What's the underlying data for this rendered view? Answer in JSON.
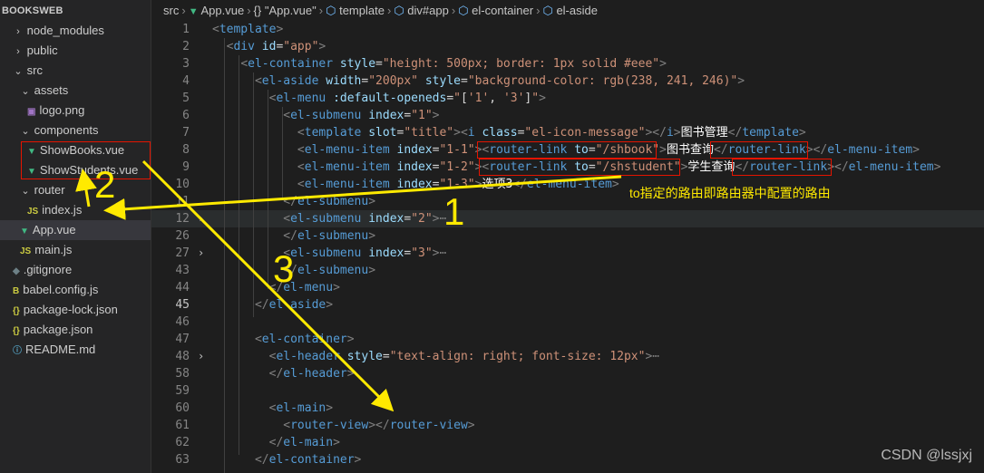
{
  "explorer": {
    "title": "BOOKSWEB",
    "items": [
      {
        "label": "node_modules",
        "twisty": "closed",
        "icon": "",
        "icon_color": ""
      },
      {
        "label": "public",
        "twisty": "closed",
        "icon": "",
        "icon_color": ""
      },
      {
        "label": "src",
        "twisty": "open",
        "icon": "",
        "icon_color": ""
      },
      {
        "label": "assets",
        "twisty": "open",
        "icon": "",
        "icon_color": ""
      },
      {
        "label": "logo.png",
        "twisty": "",
        "icon": "image-icon",
        "icon_color": "#a074c4"
      },
      {
        "label": "components",
        "twisty": "open",
        "icon": "",
        "icon_color": ""
      },
      {
        "label": "ShowBooks.vue",
        "twisty": "",
        "icon": "vue-icon",
        "icon_color": "#41b883"
      },
      {
        "label": "ShowStudents.vue",
        "twisty": "",
        "icon": "vue-icon",
        "icon_color": "#41b883"
      },
      {
        "label": "router",
        "twisty": "open",
        "icon": "",
        "icon_color": ""
      },
      {
        "label": "index.js",
        "twisty": "",
        "icon": "js-icon",
        "icon_color": "#cbcb41"
      },
      {
        "label": "App.vue",
        "twisty": "",
        "icon": "vue-icon",
        "icon_color": "#41b883"
      },
      {
        "label": "main.js",
        "twisty": "",
        "icon": "js-icon",
        "icon_color": "#cbcb41"
      },
      {
        "label": ".gitignore",
        "twisty": "",
        "icon": "git-icon",
        "icon_color": "#6d8086"
      },
      {
        "label": "babel.config.js",
        "twisty": "",
        "icon": "babel-icon",
        "icon_color": "#cbcb41"
      },
      {
        "label": "package-lock.json",
        "twisty": "",
        "icon": "json-icon",
        "icon_color": "#cbcb41"
      },
      {
        "label": "package.json",
        "twisty": "",
        "icon": "json-icon",
        "icon_color": "#cbcb41"
      },
      {
        "label": "README.md",
        "twisty": "",
        "icon": "info-icon",
        "icon_color": "#519aba"
      }
    ]
  },
  "breadcrumb": {
    "src": "src",
    "file": "App.vue",
    "obj": "{} \"App.vue\"",
    "template": "template",
    "div": "div#app",
    "container": "el-container",
    "aside": "el-aside"
  },
  "code_lines": [
    {
      "n": "1",
      "fold": "",
      "html": "<span class=\"p\">&lt;</span><span class=\"t\">template</span><span class=\"p\">&gt;</span>"
    },
    {
      "n": "2",
      "fold": "",
      "html": "  <span class=\"p\">&lt;</span><span class=\"t\">div</span> <span class=\"a\">id</span><span class=\"w\">=</span><span class=\"s\">\"app\"</span><span class=\"p\">&gt;</span>"
    },
    {
      "n": "3",
      "fold": "",
      "html": "    <span class=\"p\">&lt;</span><span class=\"t\">el-container</span> <span class=\"a\">style</span><span class=\"w\">=</span><span class=\"s\">\"height: 500px; border: 1px solid #eee\"</span><span class=\"p\">&gt;</span>"
    },
    {
      "n": "4",
      "fold": "",
      "html": "      <span class=\"p\">&lt;</span><span class=\"t\">el-aside</span> <span class=\"a\">width</span><span class=\"w\">=</span><span class=\"s\">\"200px\"</span> <span class=\"a\">style</span><span class=\"w\">=</span><span class=\"s\">\"background-color: rgb(238, 241, 246)\"</span><span class=\"p\">&gt;</span>"
    },
    {
      "n": "5",
      "fold": "",
      "html": "        <span class=\"p\">&lt;</span><span class=\"t\">el-menu</span> <span class=\"a\">:default-openeds</span><span class=\"w\">=</span><span class=\"s\">\"</span><span class=\"w\">[</span><span class=\"s\">'1'</span><span class=\"w\">, </span><span class=\"s\">'3'</span><span class=\"w\">]</span><span class=\"s\">\"</span><span class=\"p\">&gt;</span>"
    },
    {
      "n": "6",
      "fold": "",
      "html": "          <span class=\"p\">&lt;</span><span class=\"t\">el-submenu</span> <span class=\"a\">index</span><span class=\"w\">=</span><span class=\"s\">\"1\"</span><span class=\"p\">&gt;</span>"
    },
    {
      "n": "7",
      "fold": "",
      "html": "            <span class=\"p\">&lt;</span><span class=\"t\">template</span> <span class=\"a\">slot</span><span class=\"w\">=</span><span class=\"s\">\"title\"</span><span class=\"p\">&gt;&lt;</span><span class=\"t\">i</span> <span class=\"a\">class</span><span class=\"w\">=</span><span class=\"s\">\"el-icon-message\"</span><span class=\"p\">&gt;&lt;/</span><span class=\"t\">i</span><span class=\"p\">&gt;</span><span class=\"cn\">图书管理</span><span class=\"p\">&lt;/</span><span class=\"t\">template</span><span class=\"p\">&gt;</span>"
    },
    {
      "n": "8",
      "fold": "",
      "html": "            <span class=\"p\">&lt;</span><span class=\"t\">el-menu-item</span> <span class=\"a\">index</span><span class=\"w\">=</span><span class=\"s\">\"1-1\"</span><span class=\"p\">&gt;&lt;</span><span class=\"t\">router-link</span> <span class=\"a\">to</span><span class=\"w\">=</span><span class=\"s\">\"/shbook\"</span><span class=\"p\">&gt;</span><span class=\"cn\">图书查询</span><span class=\"p\">&lt;/</span><span class=\"t\">router-link</span><span class=\"p\">&gt;&lt;/</span><span class=\"t\">el-menu-item</span><span class=\"p\">&gt;</span>"
    },
    {
      "n": "9",
      "fold": "",
      "html": "            <span class=\"p\">&lt;</span><span class=\"t\">el-menu-item</span> <span class=\"a\">index</span><span class=\"w\">=</span><span class=\"s\">\"1-2\"</span><span class=\"p\">&gt;&lt;</span><span class=\"t\">router-link</span> <span class=\"a\">to</span><span class=\"w\">=</span><span class=\"s\">\"/shstudent\"</span><span class=\"p\">&gt;</span><span class=\"cn\">学生查询</span><span class=\"p\">&lt;/</span><span class=\"t\">router-link</span><span class=\"p\">&gt;&lt;/</span><span class=\"t\">el-menu-item</span><span class=\"p\">&gt;</span>"
    },
    {
      "n": "10",
      "fold": "",
      "html": "            <span class=\"p\">&lt;</span><span class=\"t\">el-menu-item</span> <span class=\"a\">index</span><span class=\"w\">=</span><span class=\"s\">\"1-3\"</span><span class=\"p\">&gt;</span><span class=\"cn\">选项3</span><span class=\"p\">&lt;/</span><span class=\"t\">el-menu-item</span><span class=\"p\">&gt;</span>"
    },
    {
      "n": "11",
      "fold": "",
      "html": "          <span class=\"p\">&lt;/</span><span class=\"t\">el-submenu</span><span class=\"p\">&gt;</span>"
    },
    {
      "n": "12",
      "fold": "›",
      "html": "          <span class=\"p\">&lt;</span><span class=\"t\">el-submenu</span> <span class=\"a\">index</span><span class=\"w\">=</span><span class=\"s\">\"2\"</span><span class=\"p\">&gt;</span><span class=\"p\">⋯</span>"
    },
    {
      "n": "26",
      "fold": "",
      "html": "          <span class=\"p\">&lt;/</span><span class=\"t\">el-submenu</span><span class=\"p\">&gt;</span>"
    },
    {
      "n": "27",
      "fold": "›",
      "html": "          <span class=\"p\">&lt;</span><span class=\"t\">el-submenu</span> <span class=\"a\">index</span><span class=\"w\">=</span><span class=\"s\">\"3\"</span><span class=\"p\">&gt;</span><span class=\"p\">⋯</span>"
    },
    {
      "n": "43",
      "fold": "",
      "html": "          <span class=\"p\">&lt;/</span><span class=\"t\">el-submenu</span><span class=\"p\">&gt;</span>"
    },
    {
      "n": "44",
      "fold": "",
      "html": "        <span class=\"p\">&lt;/</span><span class=\"t\">el-menu</span><span class=\"p\">&gt;</span>"
    },
    {
      "n": "45",
      "fold": "",
      "html": "      <span class=\"p\">&lt;/</span><span class=\"t\">el-aside</span><span class=\"p\">&gt;</span>"
    },
    {
      "n": "46",
      "fold": "",
      "html": ""
    },
    {
      "n": "47",
      "fold": "",
      "html": "      <span class=\"p\">&lt;</span><span class=\"t\">el-container</span><span class=\"p\">&gt;</span>"
    },
    {
      "n": "48",
      "fold": "›",
      "html": "        <span class=\"p\">&lt;</span><span class=\"t\">el-header</span> <span class=\"a\">style</span><span class=\"w\">=</span><span class=\"s\">\"text-align: right; font-size: 12px\"</span><span class=\"p\">&gt;</span><span class=\"p\">⋯</span>"
    },
    {
      "n": "58",
      "fold": "",
      "html": "        <span class=\"p\">&lt;/</span><span class=\"t\">el-header</span><span class=\"p\">&gt;</span>"
    },
    {
      "n": "59",
      "fold": "",
      "html": ""
    },
    {
      "n": "60",
      "fold": "",
      "html": "        <span class=\"p\">&lt;</span><span class=\"t\">el-main</span><span class=\"p\">&gt;</span>"
    },
    {
      "n": "61",
      "fold": "",
      "html": "          <span class=\"p\">&lt;</span><span class=\"t\">router-view</span><span class=\"p\">&gt;&lt;/</span><span class=\"t\">router-view</span><span class=\"p\">&gt;</span>"
    },
    {
      "n": "62",
      "fold": "",
      "html": "        <span class=\"p\">&lt;/</span><span class=\"t\">el-main</span><span class=\"p\">&gt;</span>"
    },
    {
      "n": "63",
      "fold": "",
      "html": "      <span class=\"p\">&lt;/</span><span class=\"t\">el-container</span><span class=\"p\">&gt;</span>"
    }
  ],
  "annotations": {
    "note": "to指定的路由即路由器中配置的路由",
    "num1": "1",
    "num2": "2",
    "num3": "3",
    "color": "#ffea00",
    "box_color": "#e51400"
  },
  "watermark": "CSDN @lssjxj",
  "colors": {
    "editor_bg": "#1e1e1e",
    "sidebar_bg": "#252526",
    "selected_row": "#37373d",
    "tag": "#569cd6",
    "attr": "#9cdcfe",
    "string": "#ce9178"
  }
}
